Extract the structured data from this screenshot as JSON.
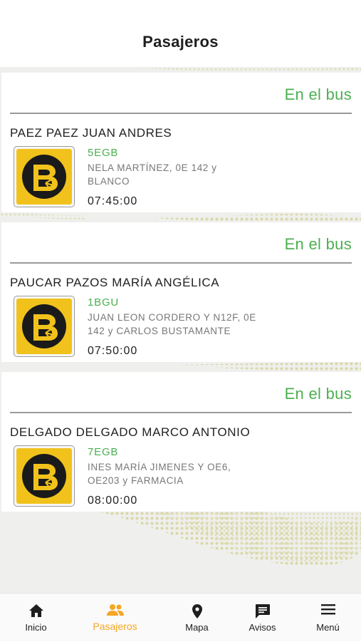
{
  "header": {
    "title": "Pasajeros"
  },
  "passengers": [
    {
      "status": "En el bus",
      "name": "PAEZ PAEZ JUAN ANDRES",
      "course": "5EGB",
      "address": "NELA MARTÍNEZ,  0E 142 y BLANCO",
      "time": "07:45:00"
    },
    {
      "status": "En el bus",
      "name": "PAUCAR PAZOS MARÍA ANGÉLICA",
      "course": "1BGU",
      "address": "JUAN LEON CORDERO Y N12F, 0E 142 y CARLOS BUSTAMANTE",
      "time": "07:50:00"
    },
    {
      "status": "En el bus",
      "name": "DELGADO DELGADO MARCO ANTONIO",
      "course": "7EGB",
      "address": "INES MARÍA JIMENES Y OE6, OE203 y FARMACIA",
      "time": "08:00:00"
    }
  ],
  "tabbar": {
    "tabs": [
      {
        "label": "Inicio",
        "icon": "home-icon"
      },
      {
        "label": "Pasajeros",
        "icon": "people-icon",
        "active": true
      },
      {
        "label": "Mapa",
        "icon": "map-pin-icon"
      },
      {
        "label": "Avisos",
        "icon": "chat-icon"
      },
      {
        "label": "Menú",
        "icon": "menu-icon"
      }
    ]
  },
  "colors": {
    "status_green": "#4caf50",
    "accent_orange": "#f5a623",
    "logo_yellow": "#f1c21b",
    "background_gray": "#efefed"
  }
}
